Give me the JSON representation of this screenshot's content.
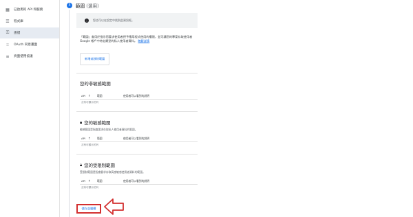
{
  "sidebar": {
    "items": [
      {
        "icon": "grid-icon",
        "label": "已啟用的 API 和服務"
      },
      {
        "icon": "library-icon",
        "label": "程式庫"
      },
      {
        "icon": "key-icon",
        "label": "憑證"
      },
      {
        "icon": "consent-icon",
        "label": "OAuth 同意畫面"
      },
      {
        "icon": "agreements-icon",
        "label": "頁面使用協議"
      }
    ],
    "active_index": 2
  },
  "step": {
    "number": "3",
    "title": "範圍",
    "optional": "(選用)"
  },
  "info": {
    "text": "您也可以在設定中找到此資訊框。"
  },
  "description": {
    "text": "「範圍」會用於指示您要求使用者授予應用程式使用的權限，並可讓您的專案存取使用者 Google 帳戶中特定類型的私人使用者資料。",
    "link": "瞭解詳情"
  },
  "buttons": {
    "add_scope": "新增或移除範圍",
    "save": "儲存並繼續"
  },
  "table_headers": {
    "api": "API",
    "scope": "範圍",
    "description": "使用者可以看到的說明"
  },
  "sections": [
    {
      "title": "您的非敏感範圍",
      "lock": false,
      "desc": "",
      "empty": "沒有可顯示的列"
    },
    {
      "title": "您的敏感範圍",
      "lock": true,
      "desc": "敏感範圍是指會要求存取私人使用者資料的範圍。",
      "empty": "沒有可顯示的列"
    },
    {
      "title": "您的受限制範圍",
      "lock": true,
      "desc": "受限制範圍是指會要求存取高度敏感使用者資料的範圍。",
      "empty": "沒有可顯示的列"
    }
  ],
  "colors": {
    "accent": "#1a73e8",
    "annotation": "#d32f2f",
    "active_nav": "#e6ebf2"
  }
}
